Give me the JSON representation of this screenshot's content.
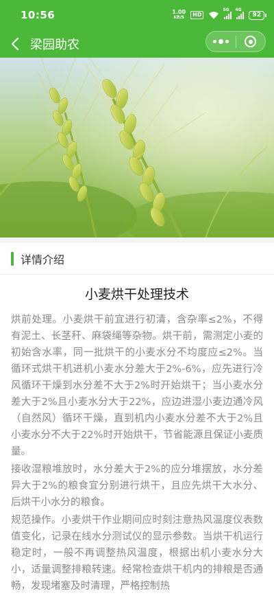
{
  "status_bar": {
    "time": "10:56",
    "net_speed_value": "1.00",
    "net_speed_unit": "KB/S",
    "hd_badge": "HD",
    "signal_1_tag": "5G",
    "signal_2_tag": "4G",
    "battery": "92"
  },
  "navbar": {
    "title": "梁园助农",
    "back_icon": "chevron-left-icon",
    "menu_icon": "more-dots-icon",
    "close_icon": "target-circle-icon"
  },
  "section": {
    "title": "详情介绍"
  },
  "article": {
    "title": "小麦烘干处理技术",
    "paragraphs": [
      "烘前处理。小麦烘干前宜进行初清，含杂率≤2%，不得有泥土、长茎秆、麻袋绳等杂物。烘干前，需测定小麦的初始含水率，同一批烘干的小麦水分不均度应≤2%。当循环式烘干机进机小麦水分差大于2%-6%，应先进行冷风循环干燥到水分差不大于2%时开始烘干；当小麦水分差大于2%且小麦水分大于22%，应边进湿小麦边通冷风（自然风）循环干燥，直到机内小麦水分差不大于2%且小麦水分不大于22%时开始烘干，节省能源且保证小麦质量。",
      "接收湿粮堆放时，水分差大于2%的应分堆摆放，水分差异大于2%的粮食宜分别进行烘干，且应先烘干大水分、后烘干小水分的粮食。",
      "规范操作。小麦烘干作业期间应时刻注意热风温度仪表数值变化，记录在线水分测试仪的显示参数。当烘干机运行稳定时，一般不再调整热风温度，根据出机小麦水分大小，适量调整排粮转速。经常检查烘干机内的排粮是否通畅，发现堵塞及时清理，严格控制热"
    ]
  },
  "colors": {
    "brand_green": "#4cb83a",
    "body_text": "#8a8a8a"
  }
}
